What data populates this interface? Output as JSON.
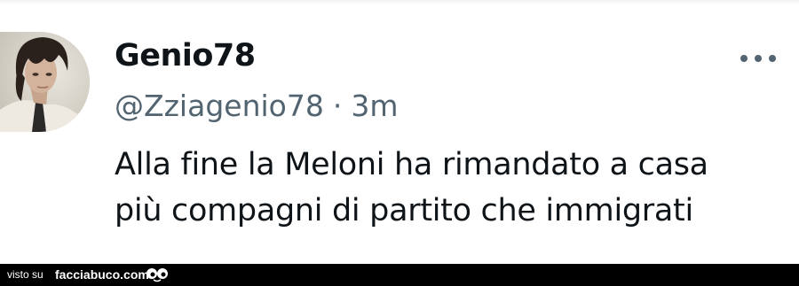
{
  "tweet": {
    "author_name": "Genio78",
    "handle": "@Zziagenio78",
    "separator": "·",
    "time": "3m",
    "text_lines": [
      "Alla fine la Meloni ha rimandato a casa",
      "più compagni di partito che immigrati"
    ],
    "avatar_icon": "profile-photo",
    "more_icon": "more-horizontal-icon"
  },
  "footer": {
    "visto_su": "visto su",
    "site": "facciabuco.com",
    "logo_icon": "facciabuco-eyes-logo"
  },
  "colors": {
    "text_primary": "#0f1419",
    "text_secondary": "#536471",
    "footer_bg": "#000000",
    "footer_text": "#ffffff"
  }
}
